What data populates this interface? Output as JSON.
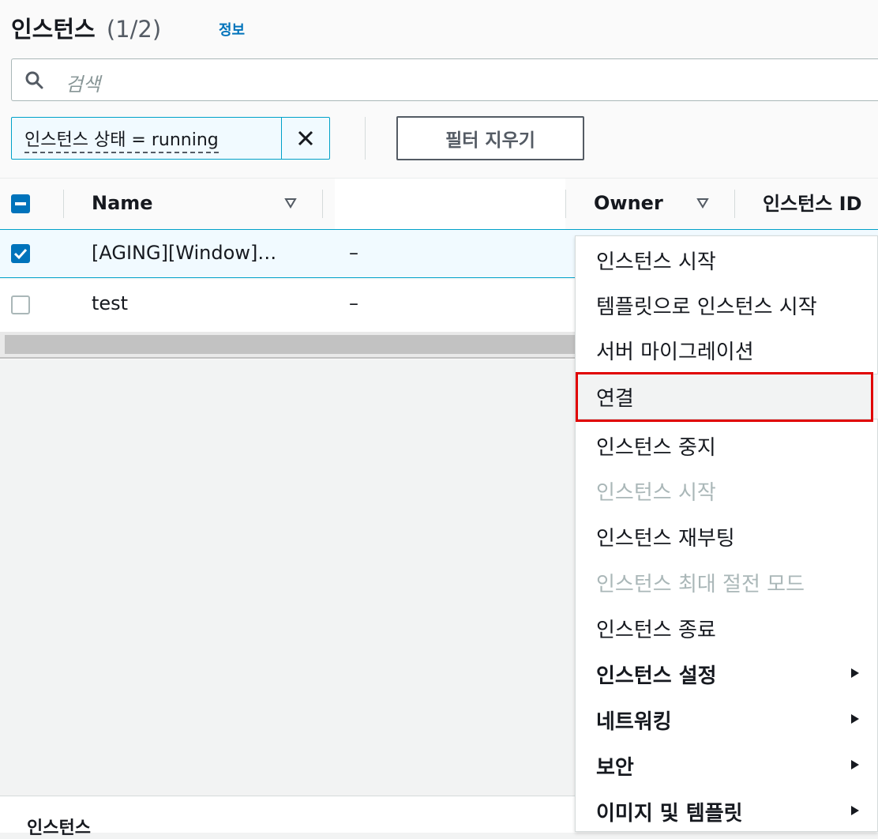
{
  "header": {
    "title": "인스턴스",
    "count": "(1/2)",
    "info_link": "정보"
  },
  "search": {
    "placeholder": "검색",
    "icon": "search-icon"
  },
  "filter": {
    "token_text": "인스턴스 상태 = running",
    "dismiss_icon": "close-icon",
    "clear_label": "필터 지우기"
  },
  "table": {
    "columns": {
      "name": "Name",
      "owner": "Owner",
      "instance_id": "인스턴스 ID"
    },
    "rows": [
      {
        "name": "[AGING][Window]…",
        "col2": "–",
        "checked": true
      },
      {
        "name": "test",
        "col2": "–",
        "checked": false
      }
    ]
  },
  "bottom": {
    "partial_text": "인스턴스"
  },
  "context_menu": {
    "items": [
      {
        "label": "인스턴스 시작",
        "disabled": false,
        "bold": false,
        "submenu": false
      },
      {
        "label": "템플릿으로 인스턴스 시작",
        "disabled": false,
        "bold": false,
        "submenu": false
      },
      {
        "label": "서버 마이그레이션",
        "disabled": false,
        "bold": false,
        "submenu": false
      },
      {
        "label": "연결",
        "disabled": false,
        "bold": false,
        "submenu": false,
        "highlighted": true
      },
      {
        "label": "인스턴스 중지",
        "disabled": false,
        "bold": false,
        "submenu": false
      },
      {
        "label": "인스턴스 시작",
        "disabled": true,
        "bold": false,
        "submenu": false
      },
      {
        "label": "인스턴스 재부팅",
        "disabled": false,
        "bold": false,
        "submenu": false
      },
      {
        "label": "인스턴스 최대 절전 모드",
        "disabled": true,
        "bold": false,
        "submenu": false
      },
      {
        "label": "인스턴스 종료",
        "disabled": false,
        "bold": false,
        "submenu": false
      },
      {
        "label": "인스턴스 설정",
        "disabled": false,
        "bold": true,
        "submenu": true
      },
      {
        "label": "네트워킹",
        "disabled": false,
        "bold": true,
        "submenu": true
      },
      {
        "label": "보안",
        "disabled": false,
        "bold": true,
        "submenu": true
      },
      {
        "label": "이미지 및 템플릿",
        "disabled": false,
        "bold": true,
        "submenu": true
      }
    ]
  },
  "colors": {
    "accent": "#0073bb",
    "highlight_outline": "#e00000",
    "disabled_text": "#aab7b8"
  }
}
